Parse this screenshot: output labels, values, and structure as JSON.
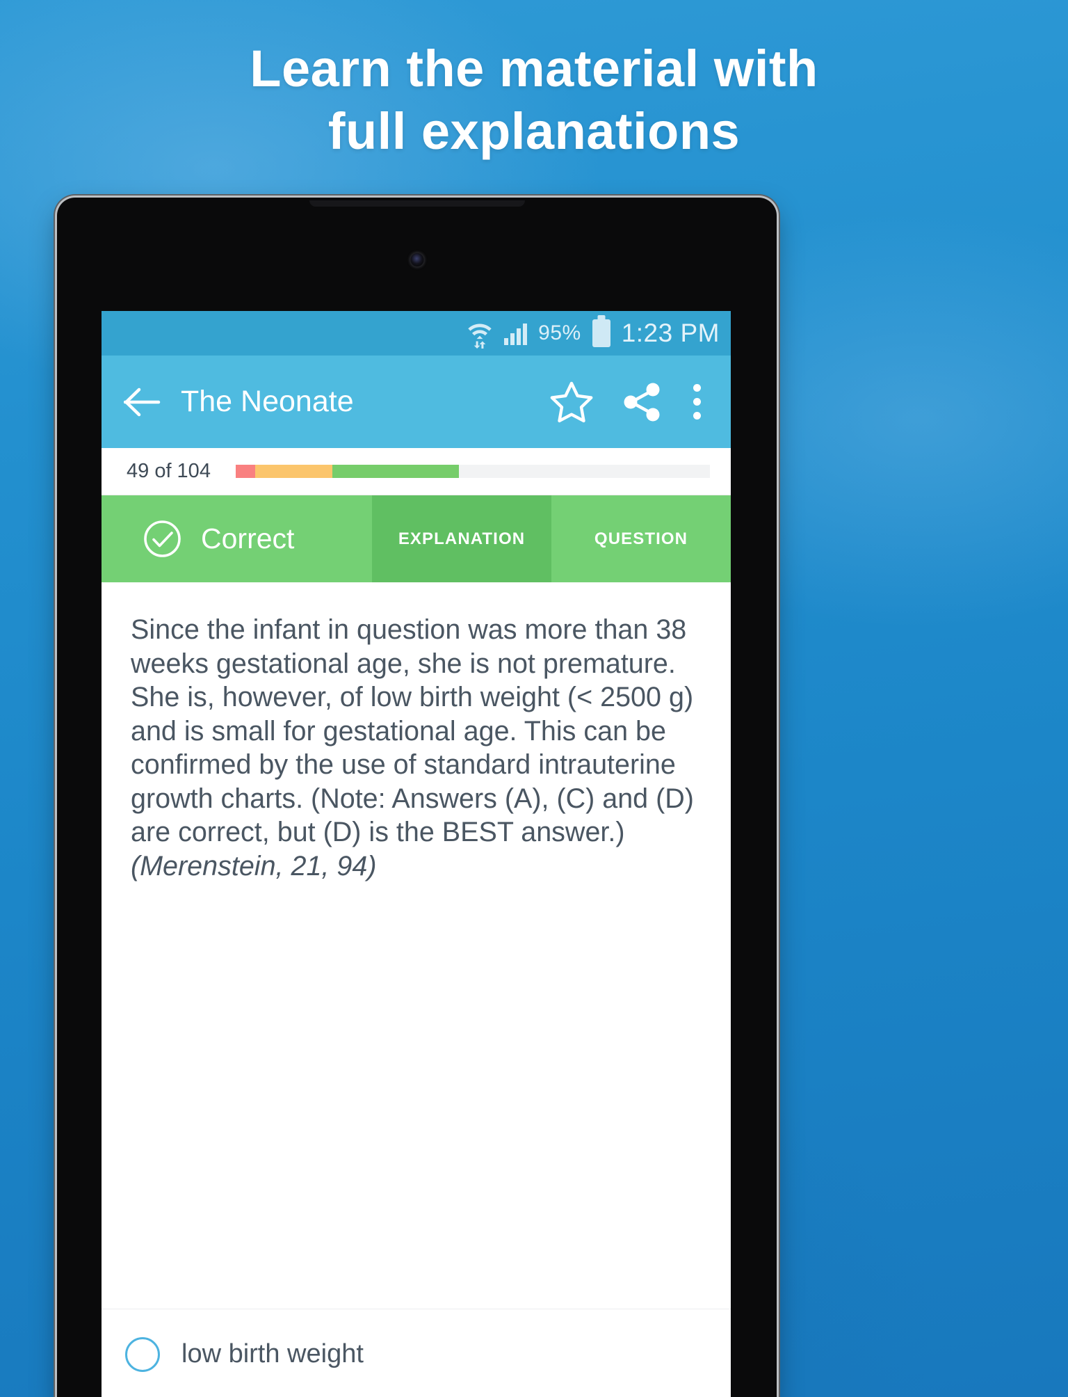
{
  "promo": {
    "headline_line1": "Learn the material with",
    "headline_line2": "full explanations",
    "background_color": "#1e8fd0",
    "headline_color": "#ffffff"
  },
  "status_bar": {
    "battery_percent": "95%",
    "time": "1:23 PM",
    "wifi_icon": "wifi-icon",
    "signal_icon": "signal-bars-icon",
    "battery_icon": "battery-icon",
    "background_color": "#34a3cf"
  },
  "app_bar": {
    "back_icon": "back-arrow-icon",
    "title": "The Neonate",
    "star_icon": "star-outline-icon",
    "share_icon": "share-icon",
    "overflow_icon": "overflow-menu-icon",
    "background_color": "#4fbbe0"
  },
  "progress": {
    "label": "49 of 104",
    "current": 49,
    "total": 104,
    "segments": [
      {
        "name": "incorrect",
        "color": "#f98080",
        "percent": 4.1
      },
      {
        "name": "partial",
        "color": "#fbc56c",
        "percent": 16.3
      },
      {
        "name": "correct",
        "color": "#76cd6a",
        "percent": 26.6
      },
      {
        "name": "remaining",
        "color": "#f2f3f4",
        "percent": 53.0
      }
    ]
  },
  "tabs": {
    "status_label": "Correct",
    "status_icon": "check-circle-icon",
    "status_color": "#74d074",
    "items": [
      {
        "label": "EXPLANATION",
        "selected": true
      },
      {
        "label": "QUESTION",
        "selected": false
      }
    ]
  },
  "explanation": {
    "text": "Since the infant in question was more than 38 weeks gestational age, she is not premature. She is, however, of low birth weight (< 2500 g) and is small for gestational age. This can be confirmed by the use of standard intrauterine growth charts. (Note: Answers (A), (C) and (D) are correct, but (D) is the BEST answer.)",
    "citation": "(Merenstein, 21, 94)",
    "text_color": "#4a5662"
  },
  "answer_option": {
    "label": "low birth weight",
    "selected": false,
    "radio_color": "#4db3e0"
  }
}
